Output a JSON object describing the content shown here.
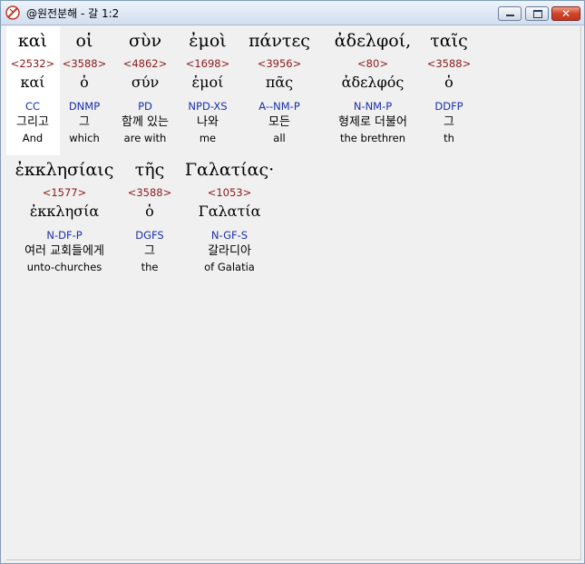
{
  "window": {
    "title": "@원전분해 - 갈 1:2"
  },
  "words": [
    {
      "greek": "καὶ",
      "strong": "<2532>",
      "lemma": "καί",
      "morph": "CC",
      "korean": "그리고",
      "english": "And"
    },
    {
      "greek": "οἱ",
      "strong": "<3588>",
      "lemma": "ὁ",
      "morph": "DNMP",
      "korean": "그",
      "english": "which"
    },
    {
      "greek": "σὺν",
      "strong": "<4862>",
      "lemma": "σύν",
      "morph": "PD",
      "korean": "함께 있는",
      "english": "are with"
    },
    {
      "greek": "ἐμοὶ",
      "strong": "<1698>",
      "lemma": "ἐμοί",
      "morph": "NPD-XS",
      "korean": "나와",
      "english": "me"
    },
    {
      "greek": "πάντες",
      "strong": "<3956>",
      "lemma": "πᾶς",
      "morph": "A--NM-P",
      "korean": "모든",
      "english": "all"
    },
    {
      "greek": "ἀδελφοί,",
      "strong": "<80>",
      "lemma": "ἀδελφός",
      "morph": "N-NM-P",
      "korean": "형제로 더불어",
      "english": "the brethren"
    },
    {
      "greek": "ταῖς",
      "strong": "<3588>",
      "lemma": "ὁ",
      "morph": "DDFP",
      "korean": "그",
      "english": "th"
    },
    {
      "greek": "ἐκκλησίαις",
      "strong": "<1577>",
      "lemma": "ἐκκλησία",
      "morph": "N-DF-P",
      "korean": "여러 교회들에게",
      "english": "unto-churches"
    },
    {
      "greek": "τῆς",
      "strong": "<3588>",
      "lemma": "ὁ",
      "morph": "DGFS",
      "korean": "그",
      "english": "the"
    },
    {
      "greek": "Γαλατίας·",
      "strong": "<1053>",
      "lemma": "Γαλατία",
      "morph": "N-GF-S",
      "korean": "갈라디아",
      "english": "of Galatia"
    }
  ]
}
